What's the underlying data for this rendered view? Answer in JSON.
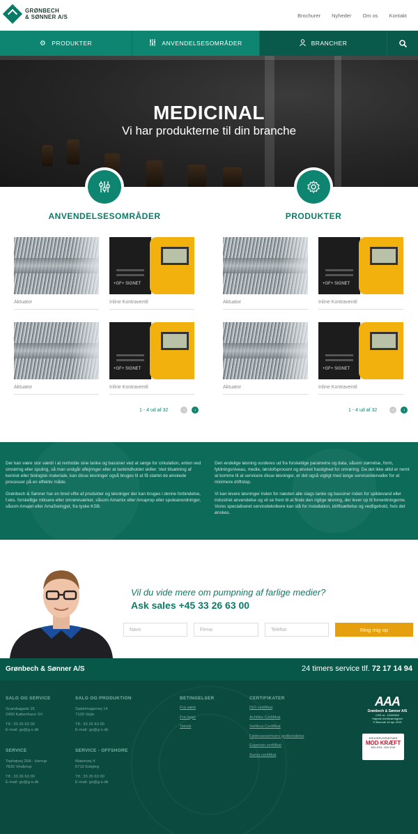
{
  "header": {
    "logo_line1": "GRØNBECH",
    "logo_line2": "& SØNNER A/S",
    "topnav": [
      "Brochurer",
      "Nyheder",
      "Om os",
      "Kontakt"
    ]
  },
  "mainnav": {
    "items": [
      "PRODUKTER",
      "ANVENDELSESOMRÅDER",
      "BRANCHER"
    ]
  },
  "hero": {
    "title": "MEDICINAL",
    "subtitle": "Vi har produkterne til din branche"
  },
  "sections": [
    {
      "title": "ANVENDELSESOMRÅDER",
      "cards": [
        "Aktuator",
        "Inline Kontraventil",
        "Aktuator",
        "Inline Kontraventil"
      ],
      "pager": "1 - 4 ud af 32"
    },
    {
      "title": "PRODUKTER",
      "cards": [
        "Aktuator",
        "Inline Kontraventil",
        "Aktuator",
        "Inline Kontraventil"
      ],
      "pager": "1 - 4 ud af 32"
    }
  ],
  "meter_label": "+GF+ SIGNET",
  "info": {
    "col1": [
      "Der kan være stor værdi i at renholde sine tanke og bassiner ved at sørge for cirkulation, enten ved omrøring eller spuling, så man undgår aflejringer eller at tankindholdet skiller. Ved tilsætning af kemisk eller biologisk materiale, kan disse løsninger også bruges til at få startet de ønskede processer på en effektiv måde.",
      "Grønbech & Sønner har en bred vifte af produkter og løsninger der kan bruges i denne forbindelse, f.eks. forskellige miksere eller omrøreværker, såsom Amamix eller Amaprop eller spuleanordninger, såsom Amajet eller AmaSwingjet, fra tyske KSB."
    ],
    "col2": [
      "Den endelige løsning vurderes ud fra forskellige parametre og data, såsom størrelse, form, fyldningsniveau, medie, tørstofsprocent og ønsket hastighed for omrøring. Da det ikke altid er nemt at komme til at servicere disse løsninger, er det også vigtigt med lange serviceintervaller for at minimere driftstop.",
      "Vi kan levere løsninger inden for næsten alle slags tanke og bassiner inden for spildevand eller industriel anvendelse og vil se frem til at finde den rigtige løsning, der lever op til forventningerne. Vores specialiseret serviceteknikere kan stå for installation, idriftsættelse og vedligehold, hvis det ønskes."
    ]
  },
  "cta": {
    "question": "Vil du vide mere om pumpning af farlige medier?",
    "call": "Ask sales +45 33 26 63 00",
    "fields": [
      "Navn",
      "Firma",
      "Telefon"
    ],
    "button": "Ring mig op"
  },
  "footer_bar": {
    "company": "Grønbech & Sønner A/S",
    "service_label": "24 timers service tlf.",
    "service_phone": "72 17 14 94"
  },
  "footer": {
    "col1_head": "SALG OG SERVICE",
    "col1_addr": [
      "Scandiagade 25",
      "2450 København SV"
    ],
    "col1_tlf": "Tlf.: 33 26 63 00",
    "col1_mail": "E-mail: gs@g-s.dk",
    "col1b_head": "SERVICE",
    "col1b_addr": [
      "Tophøjvej 26A - Herrup",
      "7830 Vinderup"
    ],
    "col1b_tlf": "Tlf.: 33 26 63 00",
    "col1b_mail": "E-mail: gs@g-s.dk",
    "col2_head": "SALG OG PRODUKTION",
    "col2_addr": [
      "Sadelmagervej 14",
      "7100 Vejle"
    ],
    "col2_tlf": "Tlf.: 33 26 63 00",
    "col2_mail": "E-mail: gs@g-s.dk",
    "col2b_head": "SERVICE - OFFSHORE",
    "col2b_addr": [
      "Materivej 4",
      "6710 Esbjerg"
    ],
    "col2b_tlf": "Tlf.: 33 26 63 00",
    "col2b_mail": "E-mail: gs@g-s.dk",
    "col3_head": "BETINGELSER",
    "col3_links": [
      "Fra værk",
      "Fra lager",
      "Teknik"
    ],
    "col4_head": "CERTIFIKATER",
    "col4_links": [
      "ISO certifikat",
      "Achilles Certifikat",
      "Sellihca Certifikat",
      "Fødevareerhverv godkendelse",
      "Experian certifikat",
      "Auma certifikat"
    ],
    "aaa": "AAA",
    "aaa_name": "Grønbech & Sønner A/S",
    "aaa_lines": [
      "CVR-nr.: 12009902",
      "Højeste kreditværdighed",
      "© Bisnode 16 apr 2015"
    ],
    "badge_line1": "ERHVERVSPARTNER",
    "badge_line2": "MOD KRÆFT",
    "badge_line3": "MAJ 2014 - MAJ 2015"
  },
  "colors": {
    "brand": "#0d8570",
    "brand_dark": "#0a5a4c",
    "accent": "#e6a00f"
  }
}
